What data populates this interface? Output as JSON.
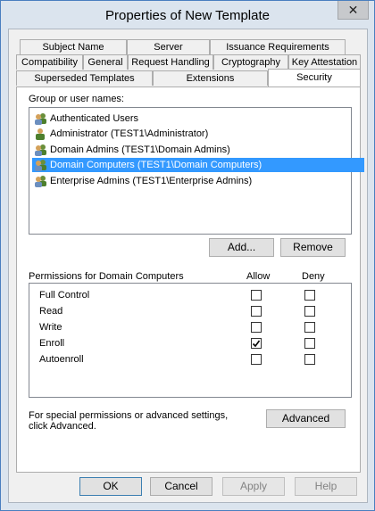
{
  "window": {
    "title": "Properties of New Template",
    "close_glyph": "✕"
  },
  "tabs_row1": [
    {
      "label": "Subject Name"
    },
    {
      "label": "Server"
    },
    {
      "label": "Issuance Requirements"
    }
  ],
  "tabs_row2": [
    {
      "label": "Compatibility"
    },
    {
      "label": "General"
    },
    {
      "label": "Request Handling"
    },
    {
      "label": "Cryptography"
    },
    {
      "label": "Key Attestation"
    }
  ],
  "tabs_row3": [
    {
      "label": "Superseded Templates"
    },
    {
      "label": "Extensions"
    },
    {
      "label": "Security",
      "selected": true
    }
  ],
  "security": {
    "group_label": "Group or user names:",
    "principals": [
      {
        "name": "Authenticated Users",
        "icon": "group-users-icon"
      },
      {
        "name": "Administrator (TEST1\\Administrator)",
        "icon": "user-icon"
      },
      {
        "name": "Domain Admins (TEST1\\Domain Admins)",
        "icon": "group-users-icon"
      },
      {
        "name": "Domain Computers (TEST1\\Domain Computers)",
        "icon": "group-users-icon",
        "selected": true
      },
      {
        "name": "Enterprise Admins (TEST1\\Enterprise Admins)",
        "icon": "group-users-icon"
      }
    ],
    "add_label": "Add...",
    "remove_label": "Remove",
    "permissions_label": "Permissions for Domain Computers",
    "allow_header": "Allow",
    "deny_header": "Deny",
    "permissions": [
      {
        "name": "Full Control",
        "allow": false,
        "deny": false
      },
      {
        "name": "Read",
        "allow": false,
        "deny": false
      },
      {
        "name": "Write",
        "allow": false,
        "deny": false
      },
      {
        "name": "Enroll",
        "allow": true,
        "deny": false
      },
      {
        "name": "Autoenroll",
        "allow": false,
        "deny": false
      }
    ],
    "advanced_note": "For special permissions or advanced settings, click Advanced.",
    "advanced_label": "Advanced"
  },
  "footer": {
    "ok_label": "OK",
    "cancel_label": "Cancel",
    "apply_label": "Apply",
    "help_label": "Help"
  },
  "colors": {
    "selection": "#3399ff",
    "window_frame": "#dbe4ee",
    "dialog_bg": "#f0f0f0"
  }
}
